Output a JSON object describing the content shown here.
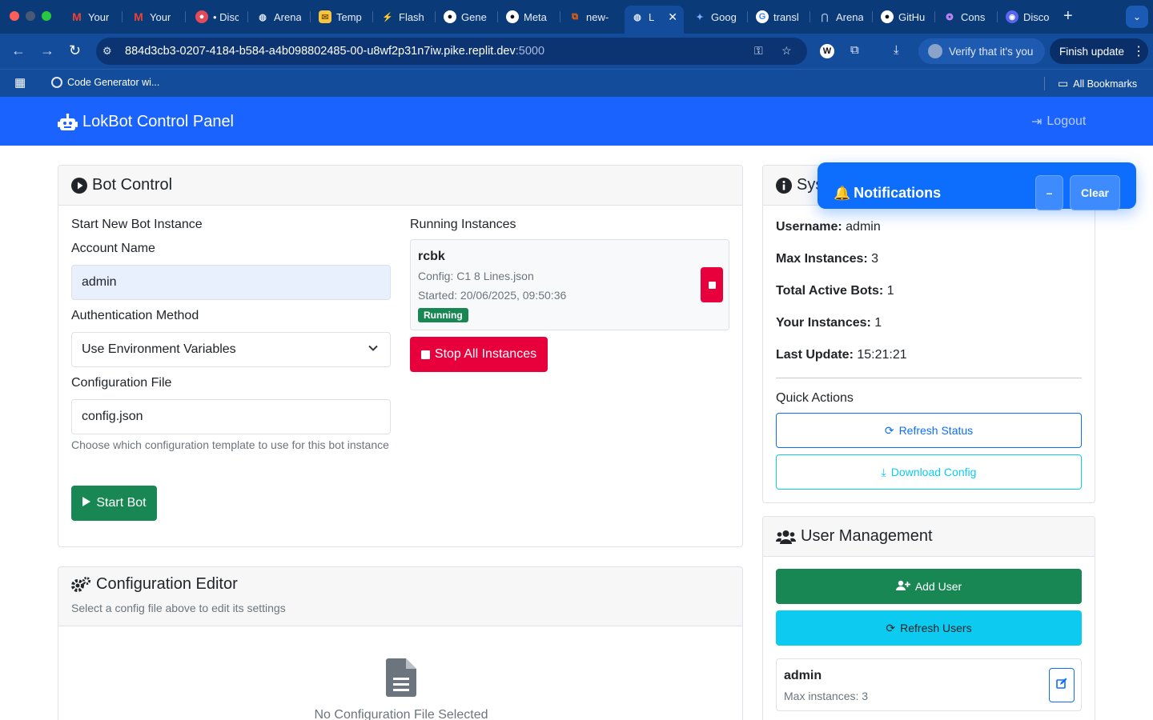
{
  "browser": {
    "tabs": [
      {
        "label": "Your"
      },
      {
        "label": "Your"
      },
      {
        "label": "• Disc"
      },
      {
        "label": "Arena"
      },
      {
        "label": "Temp"
      },
      {
        "label": "Flash"
      },
      {
        "label": "Gene"
      },
      {
        "label": "Meta"
      },
      {
        "label": "new-"
      },
      {
        "label": "L"
      },
      {
        "label": "Goog"
      },
      {
        "label": "transl"
      },
      {
        "label": "Arena"
      },
      {
        "label": "GitHu"
      },
      {
        "label": "Cons"
      },
      {
        "label": "Disco"
      }
    ],
    "url": "884d3cb3-0207-4184-b584-a4b098802485-00-u8wf2p31n7iw.pike.replit.dev",
    "url_port": ":5000",
    "verify_label": "Verify that it's you",
    "finish_update_label": "Finish update",
    "bookmark": "Code Generator wi...",
    "all_bookmarks": "All Bookmarks"
  },
  "nav": {
    "brand": "LokBot Control Panel",
    "logout": "Logout"
  },
  "bot_control": {
    "title": "Bot Control",
    "start_heading": "Start New Bot Instance",
    "account_label": "Account Name",
    "account_value": "admin",
    "auth_label": "Authentication Method",
    "auth_value": "Use Environment Variables",
    "config_label": "Configuration File",
    "config_value": "config.json",
    "config_help": "Choose which configuration template to use for this bot instance",
    "start_button": "Start Bot",
    "running_heading": "Running Instances",
    "instances": [
      {
        "name": "rcbk",
        "config": "Config: C1 8 Lines.json",
        "started": "Started: 20/06/2025, 09:50:36",
        "status": "Running"
      }
    ],
    "stop_all_button": "Stop All Instances"
  },
  "config_editor": {
    "title": "Configuration Editor",
    "subtitle": "Select a config file above to edit its settings",
    "empty_title": "No Configuration File Selected"
  },
  "system_info": {
    "title": "Sys",
    "rows": [
      {
        "label": "Username:",
        "value": "admin"
      },
      {
        "label": "Max Instances:",
        "value": "3"
      },
      {
        "label": "Total Active Bots:",
        "value": "1"
      },
      {
        "label": "Your Instances:",
        "value": "1"
      },
      {
        "label": "Last Update:",
        "value": "15:21:21"
      }
    ],
    "quick_actions_heading": "Quick Actions",
    "refresh_status": "Refresh Status",
    "download_config": "Download Config"
  },
  "notifications": {
    "title": "Notifications",
    "minimize": "–",
    "clear": "Clear"
  },
  "user_management": {
    "title": "User Management",
    "add_user": "Add User",
    "refresh_users": "Refresh Users",
    "users": [
      {
        "name": "admin",
        "max": "Max instances: 3"
      }
    ]
  },
  "colors": {
    "primary": "#0d6efd",
    "success": "#198754",
    "danger": "#e8003d",
    "info": "#0dcaf0",
    "chrome_dark": "#0b3a78"
  }
}
